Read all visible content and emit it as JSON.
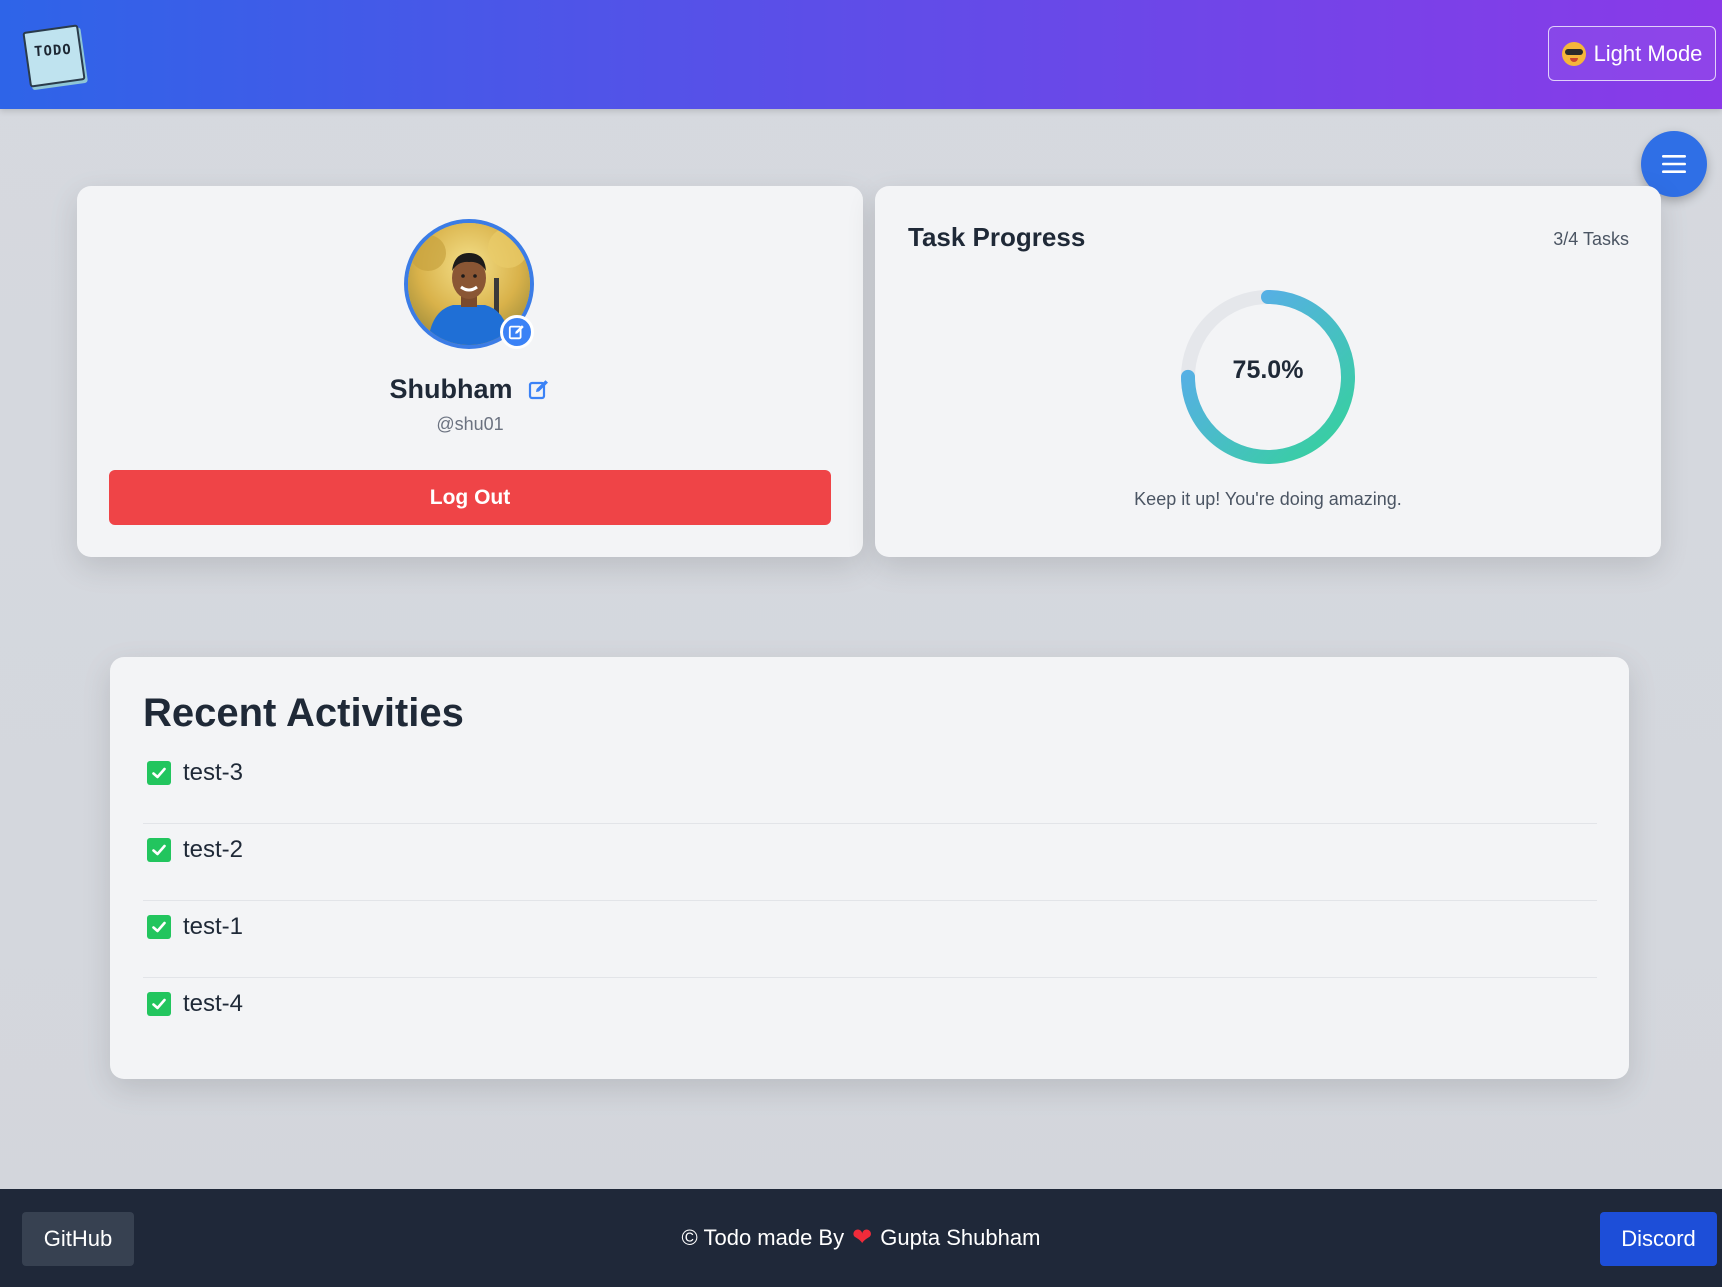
{
  "header": {
    "logo_text": "TODO",
    "mode_button_label": "Light Mode",
    "mode_icon": "sunglasses-emoji-icon"
  },
  "menu": {
    "icon": "hamburger-menu-icon"
  },
  "profile": {
    "name": "Shubham",
    "handle": "@shu01",
    "logout_label": "Log Out",
    "avatar_icon": "profile-photo",
    "edit_icon": "edit-icon"
  },
  "progress": {
    "title": "Task Progress",
    "count_label": "3/4 Tasks",
    "completed": 3,
    "total": 4,
    "percent_label": "75.0%",
    "percent": 75.0,
    "message": "Keep it up! You're doing amazing.",
    "ring_start_color": "#34d399",
    "ring_end_color": "#60a5fa",
    "ring_track_color": "#e5e7eb"
  },
  "activities": {
    "title": "Recent Activities",
    "items": [
      {
        "label": "test-3",
        "checked": true
      },
      {
        "label": "test-2",
        "checked": true
      },
      {
        "label": "test-1",
        "checked": true
      },
      {
        "label": "test-4",
        "checked": true
      }
    ],
    "check_color": "#22c55e"
  },
  "footer": {
    "github_label": "GitHub",
    "credit_prefix": "© Todo made By",
    "credit_author": "Gupta Shubham",
    "discord_label": "Discord",
    "heart_icon": "heart-icon"
  },
  "colors": {
    "logout": "#ef4447",
    "accent": "#3b82f6",
    "footer_bg": "#1f2839",
    "discord": "#1d4ed8"
  }
}
